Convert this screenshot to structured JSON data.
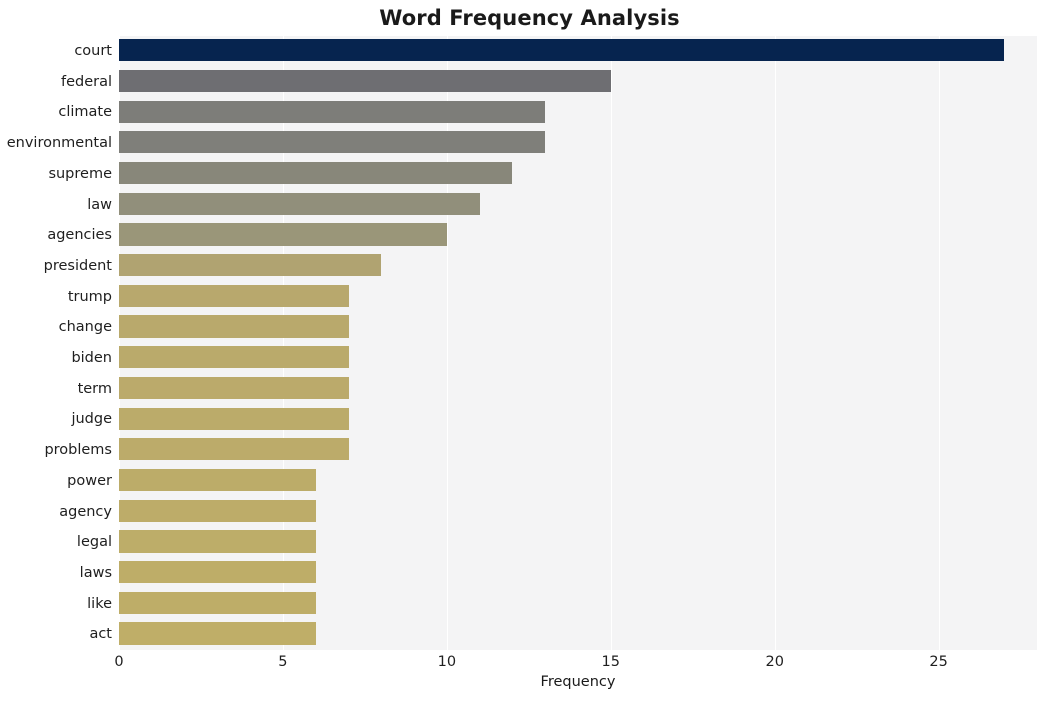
{
  "chart_data": {
    "type": "bar",
    "orientation": "horizontal",
    "title": "Word Frequency Analysis",
    "xlabel": "Frequency",
    "ylabel": "",
    "xlim": [
      0,
      28
    ],
    "xticks": [
      0,
      5,
      10,
      15,
      20,
      25
    ],
    "xticklabels": [
      "0",
      "5",
      "10",
      "15",
      "20",
      "25"
    ],
    "grid": "vertical-only",
    "legend": "none",
    "categories": [
      "court",
      "federal",
      "climate",
      "environmental",
      "supreme",
      "law",
      "agencies",
      "president",
      "trump",
      "change",
      "biden",
      "term",
      "judge",
      "problems",
      "power",
      "agency",
      "legal",
      "laws",
      "like",
      "act"
    ],
    "values": [
      27,
      15,
      13,
      13,
      12,
      11,
      10,
      8,
      7,
      7,
      7,
      7,
      7,
      7,
      6,
      6,
      6,
      6,
      6,
      6
    ],
    "bar_colors": [
      "#06244f",
      "#6e6e72",
      "#7d7d79",
      "#7f7f7a",
      "#88877a",
      "#918f7b",
      "#9a9679",
      "#b0a371",
      "#b8a86d",
      "#b9a96c",
      "#baaa6b",
      "#bbaa6b",
      "#bbab6a",
      "#bcab6a",
      "#bcac69",
      "#bdac69",
      "#bdad69",
      "#bead68",
      "#bead68",
      "#bfae68"
    ]
  },
  "style": {
    "figure_background": "#ffffff",
    "axes_background": "#f4f4f5",
    "grid_color": "#ffffff",
    "text_color": "#1a1a1a"
  }
}
